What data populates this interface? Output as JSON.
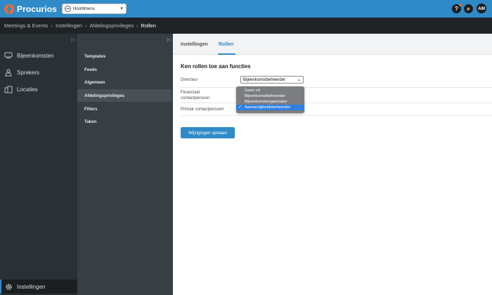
{
  "app": {
    "logo_text": "Procurios"
  },
  "topbar": {
    "menu_label": "Hoofdmenu",
    "help_label": "?",
    "search_label": "⌕",
    "avatar_initials": "AM",
    "accent_color": "#2f8ac8",
    "logo_color": "#f26a2e"
  },
  "breadcrumb": {
    "items": [
      "Meetings & Events",
      "Instellingen",
      "Afdelingsprivileges"
    ],
    "separator": "›",
    "current": "Rollen"
  },
  "leftnav": {
    "collapse_label": "|<",
    "items": [
      {
        "label": "Bijeenkomsten",
        "icon": "meetings-icon"
      },
      {
        "label": "Sprekers",
        "icon": "speakers-icon"
      },
      {
        "label": "Locaties",
        "icon": "locations-icon"
      }
    ],
    "bottom_item": {
      "label": "Instellingen",
      "icon": "gear-icon"
    }
  },
  "subnav": {
    "collapse_label": "|<",
    "items": [
      "Templates",
      "Feeds",
      "Algemeen",
      "Afdelingsprivileges",
      "Filters",
      "Taken"
    ],
    "active_index": 3
  },
  "main": {
    "tabs": [
      "Instellingen",
      "Rollen"
    ],
    "active_tab": "Rollen",
    "section_title": "Ken rollen toe aan functies",
    "rows": [
      {
        "label": "Directeur"
      },
      {
        "label_line1": "Financieel",
        "label_line2": "contactpersoon"
      },
      {
        "label": "Primair contactpersoon"
      }
    ],
    "select_value": "Bijeenkomstbeheerder",
    "dropdown_options": [
      "Geen rol",
      "Bijeenkomstbeheerder",
      "Bijeenkomstorganisator",
      "Aanwezigheidsbeheerder"
    ],
    "dropdown_selected": "Aanwezigheidsbeheerder",
    "save_label": "Wijzigingen opslaan"
  }
}
